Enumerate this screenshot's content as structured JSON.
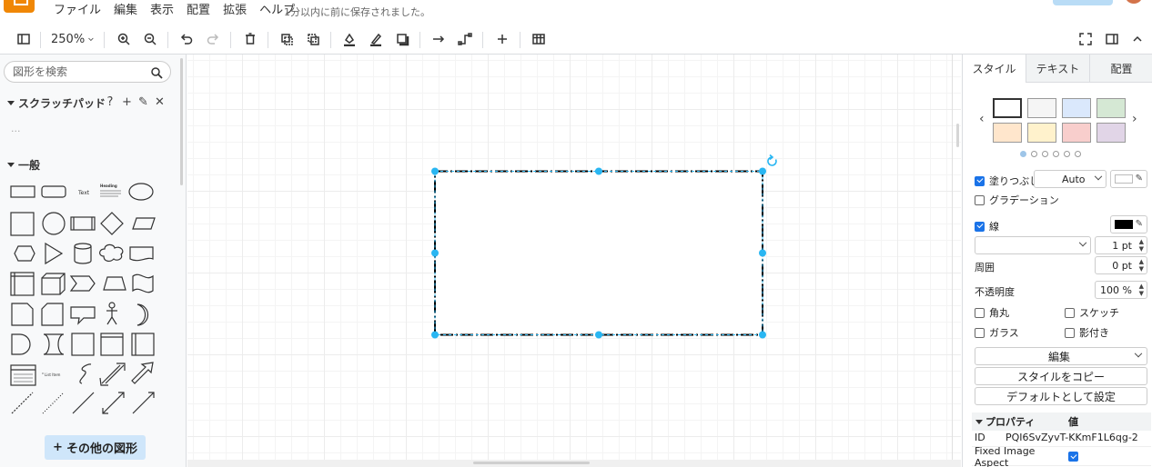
{
  "menubar": {
    "items": [
      "ファイル",
      "編集",
      "表示",
      "配置",
      "拡張",
      "ヘルプ"
    ],
    "save_status": "1分以内に前に保存されました。"
  },
  "toolbar": {
    "zoom": "250%"
  },
  "sidebar": {
    "search_placeholder": "図形を検索",
    "scratchpad_title": "スクラッチパッド",
    "scratchpad_actions": [
      "?",
      "+",
      "✎",
      "✕"
    ],
    "scratchpad_empty": "···",
    "general_title": "一般",
    "more_shapes": "その他の図形",
    "shape_text_label": "Text",
    "shape_heading_label": "Heading",
    "shape_list_label": "List Item"
  },
  "canvas": {
    "selected_shape": "rectangle"
  },
  "format_panel": {
    "tabs": [
      "スタイル",
      "テキスト",
      "配置"
    ],
    "swatch_colors": [
      "#ffffff",
      "#f5f5f5",
      "#dae8fc",
      "#d5e8d4",
      "#ffe6cc",
      "#fff2cc",
      "#f8cecc",
      "#e1d5e7"
    ],
    "fill_label": "塗りつぶし",
    "fill_mode": "Auto",
    "gradient_label": "グラデーション",
    "line_label": "線",
    "line_color": "#000000",
    "line_width": "1 pt",
    "perimeter_label": "周囲",
    "perimeter_value": "0 pt",
    "opacity_label": "不透明度",
    "opacity_value": "100 %",
    "rounded_label": "角丸",
    "sketch_label": "スケッチ",
    "glass_label": "ガラス",
    "shadow_label": "影付き",
    "edit_button": "編集",
    "copy_style_button": "スタイルをコピー",
    "set_default_button": "デフォルトとして設定",
    "properties_header": "プロパティ",
    "value_header": "値",
    "id_key": "ID",
    "id_value": "PQI6SvZyvT-KKmF1L6qg-2",
    "fixed_aspect_key": "Fixed Image Aspect"
  }
}
